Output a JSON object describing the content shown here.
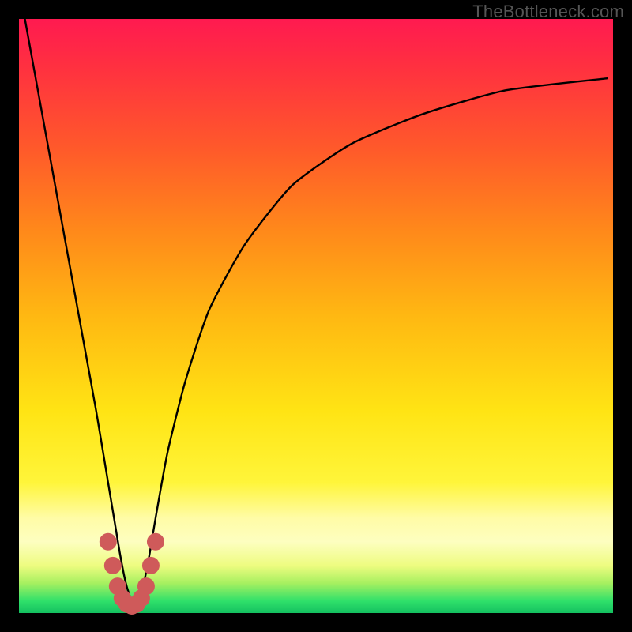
{
  "watermark": "TheBottleneck.com",
  "chart_data": {
    "type": "line",
    "title": "",
    "xlabel": "",
    "ylabel": "",
    "xlim": [
      0,
      100
    ],
    "ylim": [
      0,
      100
    ],
    "grid": false,
    "legend": false,
    "notes": "Bottleneck-style V-curve. x and y are in percent of plot width/height; y=100 is top, y=0 is bottom. Minimum (~0%) is around x≈19. Left branch descends steeply from top-left; right branch rises concave toward upper-right.",
    "series": [
      {
        "name": "curve",
        "color": "#000000",
        "x": [
          1,
          3,
          5,
          7,
          9,
          11,
          13,
          15,
          16,
          17,
          18,
          19,
          20,
          21,
          22,
          23,
          25,
          28,
          32,
          38,
          46,
          56,
          68,
          82,
          99
        ],
        "y": [
          100,
          89,
          78,
          67,
          56,
          45,
          34,
          22,
          16,
          10,
          5,
          2,
          2,
          5,
          10,
          16,
          27,
          39,
          51,
          62,
          72,
          79,
          84,
          88,
          90
        ]
      },
      {
        "name": "valley-marker",
        "color": "#cf5a5a",
        "x": [
          15.0,
          15.8,
          16.6,
          17.4,
          18.2,
          19.0,
          19.8,
          20.6,
          21.4,
          22.2,
          23.0
        ],
        "y": [
          12.0,
          8.0,
          4.5,
          2.5,
          1.5,
          1.2,
          1.5,
          2.5,
          4.5,
          8.0,
          12.0
        ]
      }
    ]
  }
}
